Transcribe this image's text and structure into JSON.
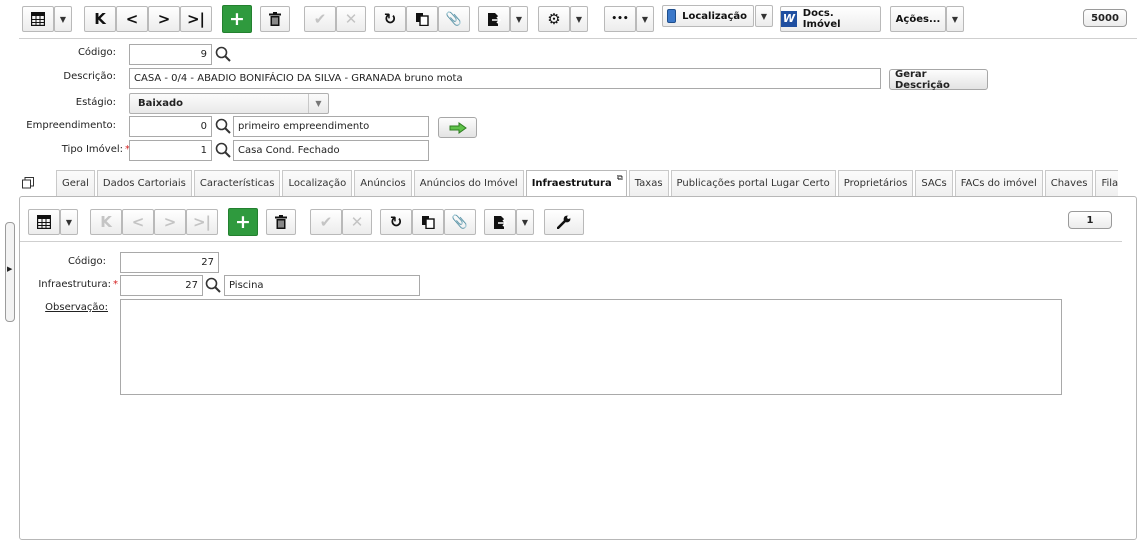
{
  "toolbar": {
    "localizacao_label": "Localização",
    "docs_label": "Docs. Imóvel",
    "acoes_label": "Ações...",
    "record_count": "5000",
    "more_label": "•••"
  },
  "form": {
    "codigo_label": "Código:",
    "codigo_value": "9",
    "descricao_label": "Descrição:",
    "descricao_value": "CASA - 0/4 - ABADIO BONIFÁCIO DA SILVA - GRANADA bruno mota",
    "gerar_descricao_label": "Gerar Descrição",
    "estagio_label": "Estágio:",
    "estagio_value": "Baixado",
    "empreendimento_label": "Empreendimento:",
    "empreendimento_code": "0",
    "empreendimento_desc": "primeiro empreendimento",
    "tipo_imovel_label": "Tipo Imóvel:",
    "tipo_imovel_code": "1",
    "tipo_imovel_desc": "Casa Cond. Fechado",
    "required_mark": "*"
  },
  "tabs": [
    {
      "label": "Geral"
    },
    {
      "label": "Dados Cartoriais"
    },
    {
      "label": "Características"
    },
    {
      "label": "Localização"
    },
    {
      "label": "Anúncios"
    },
    {
      "label": "Anúncios do Imóvel"
    },
    {
      "label": "Infraestrutura",
      "active": true
    },
    {
      "label": "Taxas"
    },
    {
      "label": "Publicações portal Lugar Certo"
    },
    {
      "label": "Proprietários"
    },
    {
      "label": "SACs"
    },
    {
      "label": "FACs do imóvel"
    },
    {
      "label": "Chaves"
    },
    {
      "label": "Fila"
    }
  ],
  "subform": {
    "record_count": "1",
    "codigo_label": "Código:",
    "codigo_value": "27",
    "infra_label": "Infraestrutura:",
    "infra_code": "27",
    "infra_desc": "Piscina",
    "observacao_label": "Observação:",
    "observacao_value": ""
  },
  "colors": {
    "accent_green": "#2f9a3e",
    "required_red": "#d42020"
  },
  "icons": [
    "grid-icon",
    "first-icon",
    "prev-icon",
    "next-icon",
    "last-icon",
    "add-icon",
    "trash-icon",
    "check-icon",
    "cancel-icon",
    "refresh-icon",
    "copy-icon",
    "attach-icon",
    "export-icon",
    "gear-icon",
    "wrench-icon",
    "search-icon",
    "arrow-right-icon",
    "window-icon"
  ]
}
